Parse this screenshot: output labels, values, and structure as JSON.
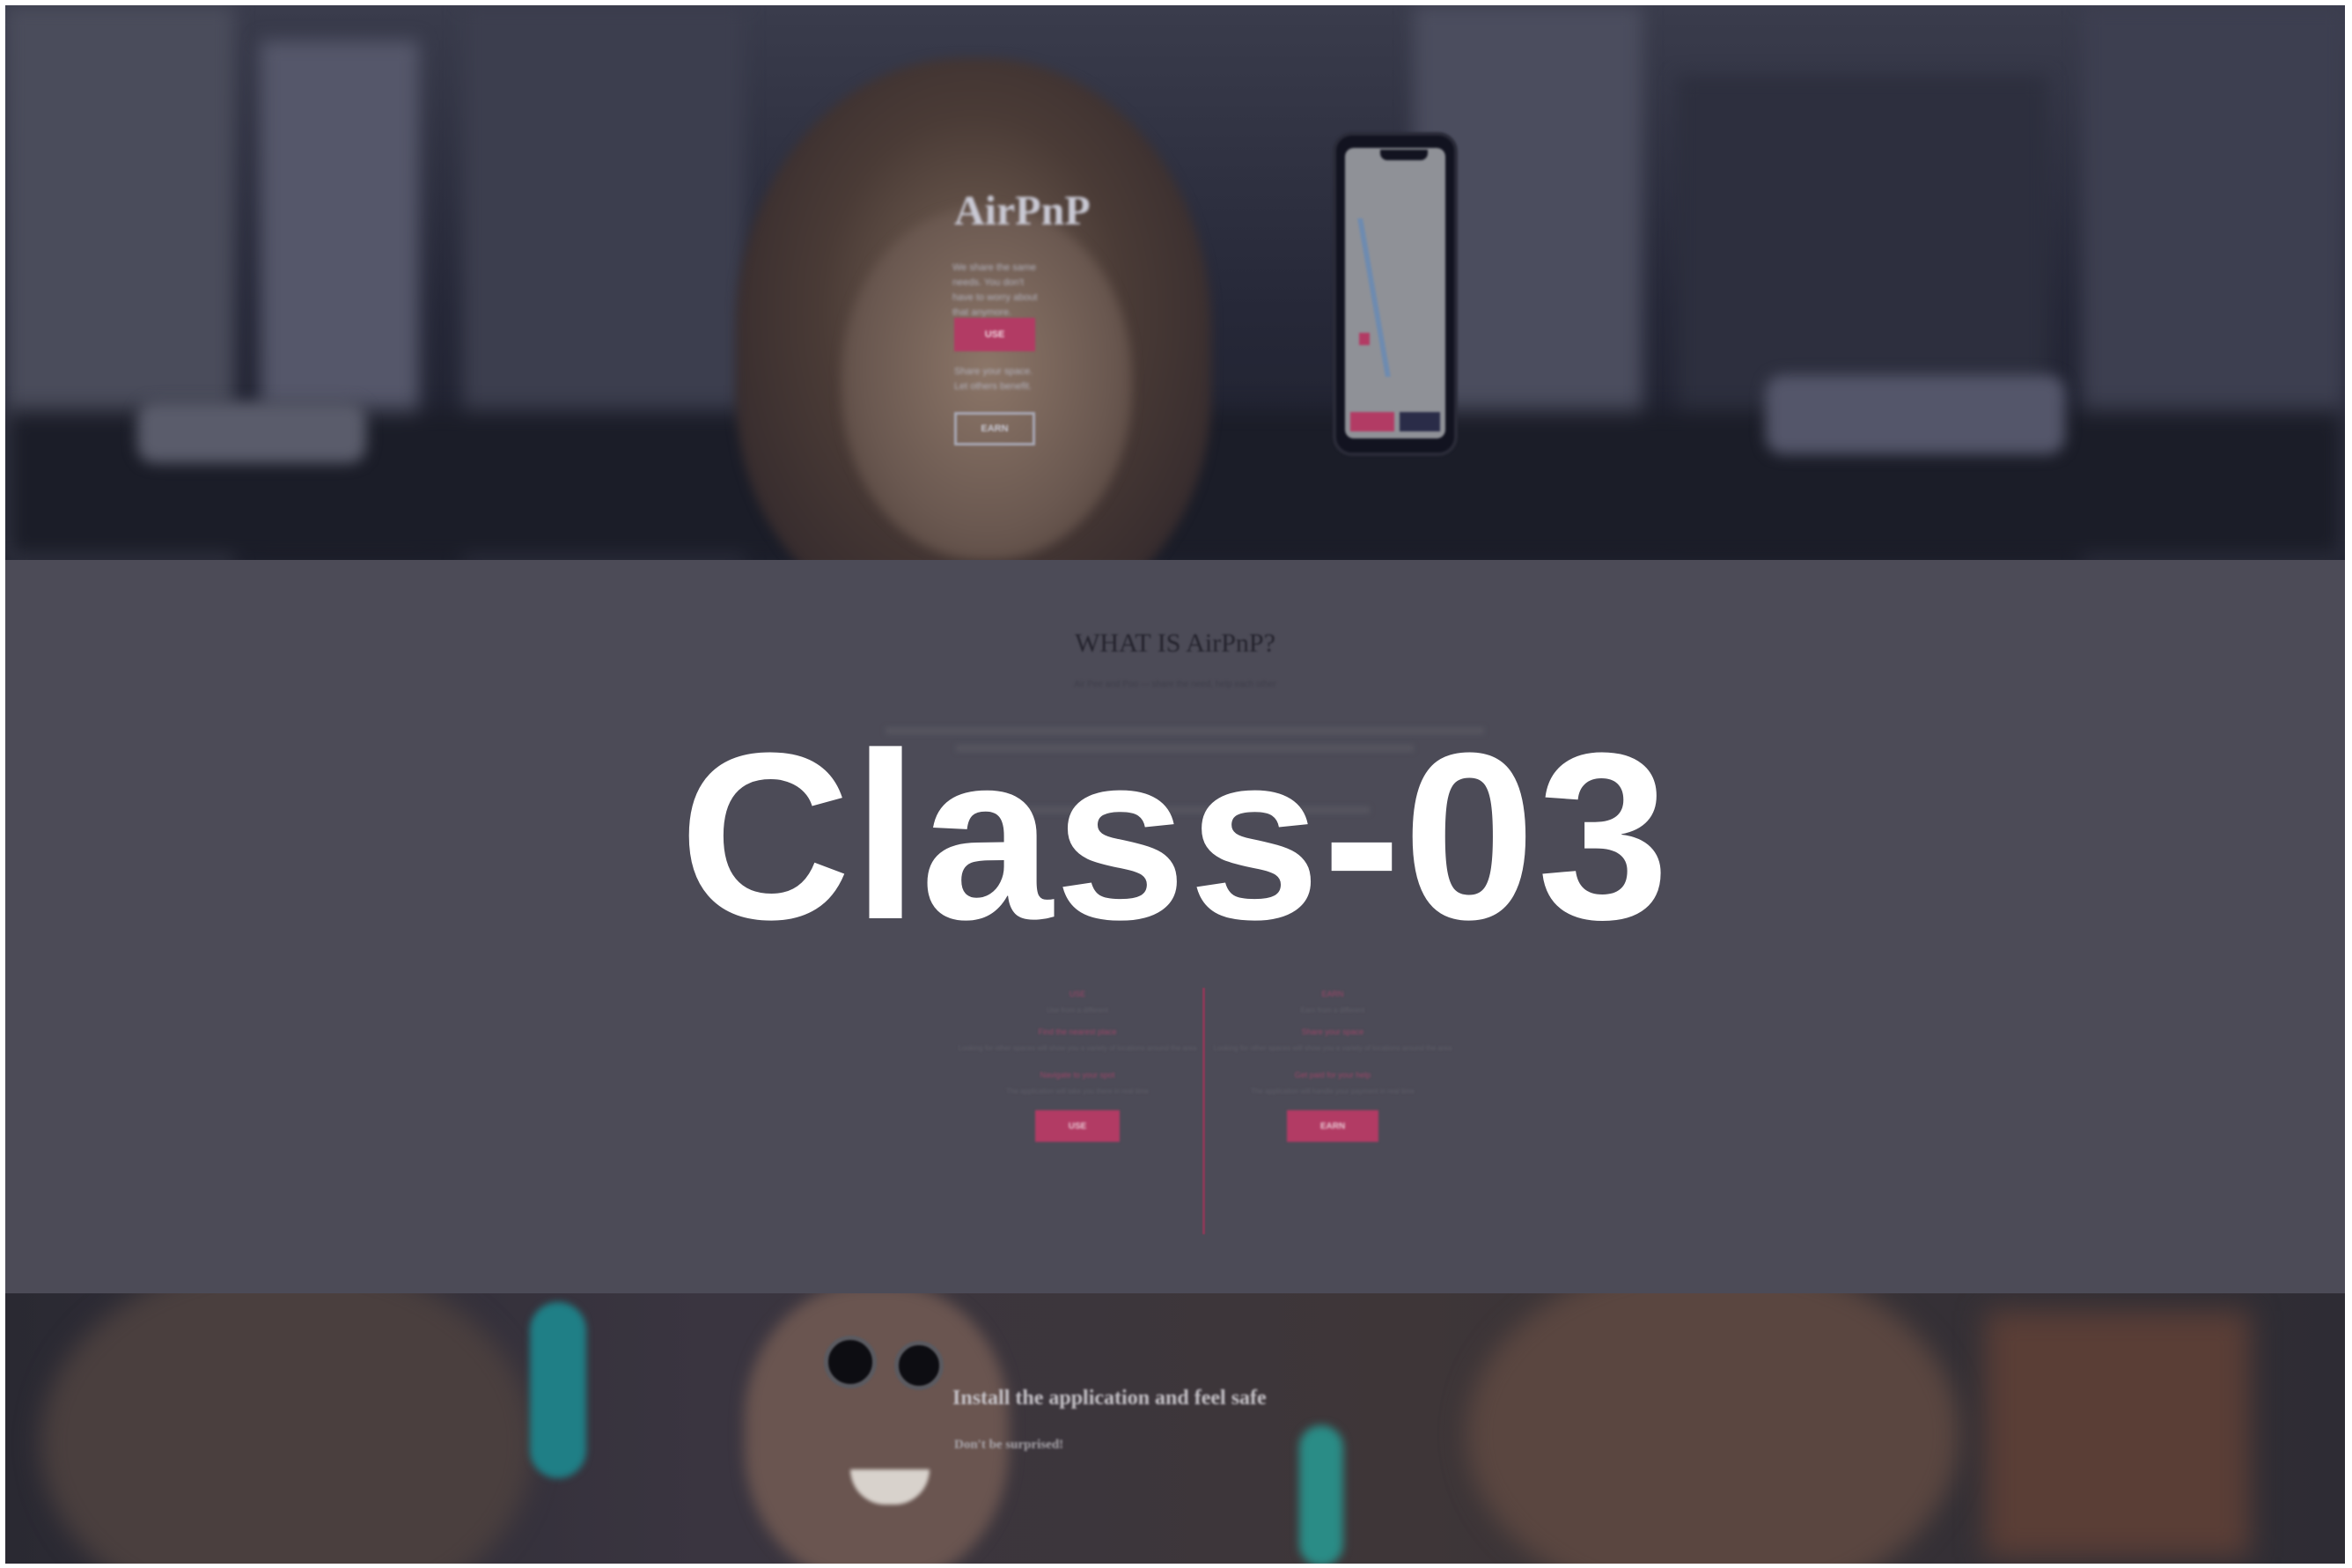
{
  "overlay": {
    "title": "Class-03"
  },
  "hero": {
    "title": "AirPnP",
    "tagline": "We share the same needs. You don't have to worry about that anymore.",
    "primary_button": "USE",
    "sub_text": "Share your space. Let others benefit.",
    "secondary_button": "EARN"
  },
  "about": {
    "heading": "WHAT IS AirPnP?",
    "subheading": "Air Pee and Poo — share the need, help each other",
    "columns": [
      {
        "title": "USE",
        "desc": "Use from a different",
        "step1_title": "Find the nearest place",
        "step1_desc": "Looking for other spaces will show you a variety of locations around the area",
        "step2_title": "Navigate to your spot",
        "step2_desc": "The application will take you there in real time",
        "button": "USE"
      },
      {
        "title": "EARN",
        "desc": "Earn from a different",
        "step1_title": "Share your space",
        "step1_desc": "Looking for other spaces will show you a variety of locations around the area",
        "step2_title": "Get paid for your help",
        "step2_desc": "The application will handle your payment in real time",
        "button": "EARN"
      }
    ]
  },
  "install": {
    "title": "Install the application and feel safe",
    "subtitle": "Don't be surprised!"
  },
  "colors": {
    "accent": "#b23b64",
    "overlay": "#4c4b57",
    "dark": "#1c1e2e"
  }
}
